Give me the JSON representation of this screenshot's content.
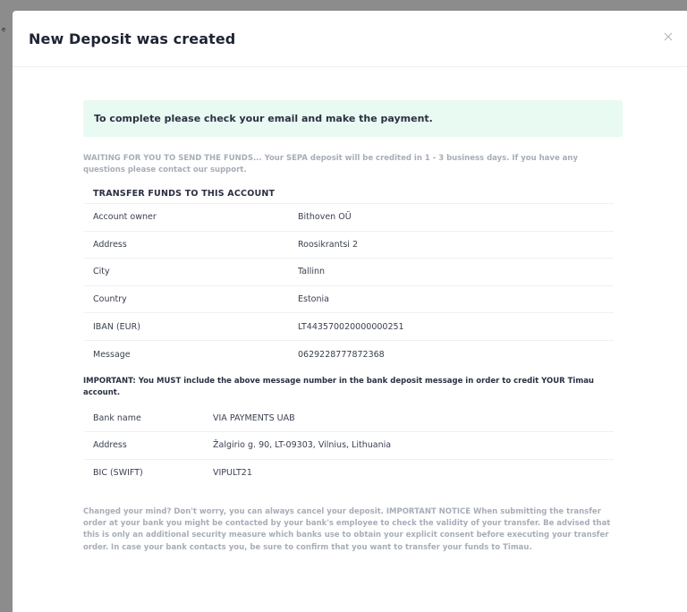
{
  "modal": {
    "title": "New Deposit was created",
    "close_icon": "close-icon"
  },
  "alert": {
    "text": "To complete please check your email and make the payment."
  },
  "waiting_text": "WAITING FOR YOU TO SEND THE FUNDS... Your SEPA deposit will be credited in 1 - 3 business days. If you have any questions please contact our support.",
  "transfer": {
    "title": "TRANSFER FUNDS TO THIS ACCOUNT",
    "rows": [
      {
        "label": "Account owner",
        "value": "Bithoven OÜ"
      },
      {
        "label": "Address",
        "value": "Roosikrantsi 2"
      },
      {
        "label": "City",
        "value": "Tallinn"
      },
      {
        "label": "Country",
        "value": "Estonia"
      },
      {
        "label": "IBAN (EUR)",
        "value": "LT443570020000000251"
      },
      {
        "label": "Message",
        "value": "0629228777872368"
      }
    ]
  },
  "important_text": "IMPORTANT: You MUST include the above message number in the bank deposit message in order to credit YOUR Timau account.",
  "bank": {
    "rows": [
      {
        "label": "Bank name",
        "value": "VIA PAYMENTS UAB"
      },
      {
        "label": "Address",
        "value": "Žalgirio g. 90, LT-09303, Vilnius, Lithuania"
      },
      {
        "label": "BIC (SWIFT)",
        "value": "VIPULT21"
      }
    ]
  },
  "notice_text": "Changed your mind? Don't worry, you can always cancel your deposit. IMPORTANT NOTICE When submitting the transfer order at your bank you might be contacted by your bank's employee to check the validity of your transfer. Be advised that this is only an additional security measure which banks use to obtain your explicit consent before executing your transfer order. In case your bank contacts you, be sure to confirm that you want to transfer your funds to Timau.",
  "backdrop_char": "e",
  "colors": {
    "alert_bg": "#e8faf2",
    "muted_text": "#a7adb8",
    "title_text": "#1f2433"
  }
}
